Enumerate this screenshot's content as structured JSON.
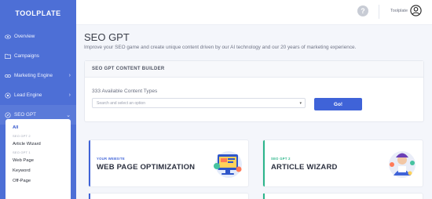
{
  "brand": "TOOLPLATE",
  "sidebar": {
    "items": [
      {
        "label": "Overview",
        "icon": "eye-icon",
        "chevron": false
      },
      {
        "label": "Campaigns",
        "icon": "folder-icon",
        "chevron": false
      },
      {
        "label": "Marketing Engine",
        "icon": "link-icon",
        "chevron": true
      },
      {
        "label": "Lead Engine",
        "icon": "target-icon",
        "chevron": true
      },
      {
        "label": "SEO GPT",
        "icon": "compass-icon",
        "chevron": true
      }
    ],
    "submenu": [
      {
        "label": "All",
        "type": "item",
        "active": true
      },
      {
        "label": "SEO GPT 2",
        "type": "header"
      },
      {
        "label": "Article Wizard",
        "type": "item"
      },
      {
        "label": "SEO GPT 1",
        "type": "header"
      },
      {
        "label": "Web Page",
        "type": "item"
      },
      {
        "label": "Keyword",
        "type": "item"
      },
      {
        "label": "Off-Page",
        "type": "item"
      }
    ]
  },
  "topbar": {
    "help_icon": "question-icon",
    "user_name": "Toolplate",
    "avatar_icon": "user-circle-icon"
  },
  "main": {
    "title": "SEO GPT",
    "subtitle": "Improve your SEO game and create unique content driven by our AI technology and our 20 years of marketing experience."
  },
  "builder": {
    "header": "SEO GPT CONTENT BUILDER",
    "available": "333 Available Content Types",
    "select_placeholder": "Search and select an option",
    "go_label": "Go!"
  },
  "cards": [
    {
      "kicker": "YOUR WEBSITE",
      "title": "WEB PAGE OPTIMIZATION",
      "accent": "#3f63d8"
    },
    {
      "kicker": "SEO GPT 2",
      "title": "ARTICLE WIZARD",
      "accent": "#2bb58a"
    }
  ],
  "colors": {
    "sidebar": "#4d6fd6",
    "primary": "#3f63d8",
    "green": "#2bb58a"
  }
}
